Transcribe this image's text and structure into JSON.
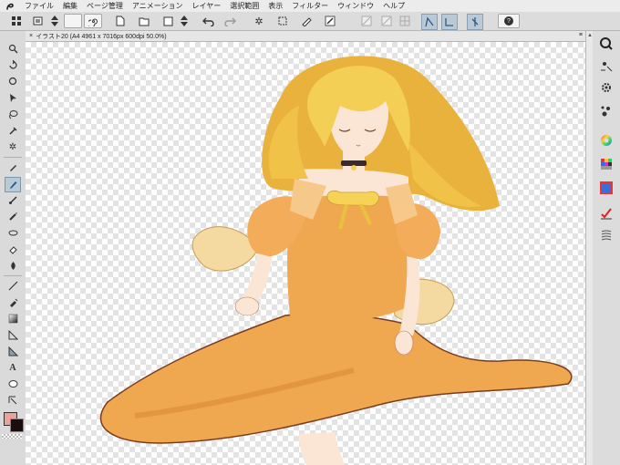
{
  "menu": {
    "items": [
      "ファイル",
      "編集",
      "ページ管理",
      "アニメーション",
      "レイヤー",
      "選択範囲",
      "表示",
      "フィルター",
      "ウィンドウ",
      "ヘルプ"
    ]
  },
  "toolbar": {
    "help_label": "?"
  },
  "document": {
    "tab_title": "イラスト20 (A4 4961 x 7016px 600dpi 50.0%)",
    "close_symbol": "×",
    "menu_symbol": "≡"
  },
  "tools": {
    "text_tool_glyph": "A"
  },
  "colors": {
    "main_color": "#e8a49a",
    "sub_color": "#1a0d0d",
    "hair": "#f3cf55",
    "dress": "#f0a850",
    "skin": "#fbe6d6",
    "accent_active": "#b9c9d6"
  }
}
